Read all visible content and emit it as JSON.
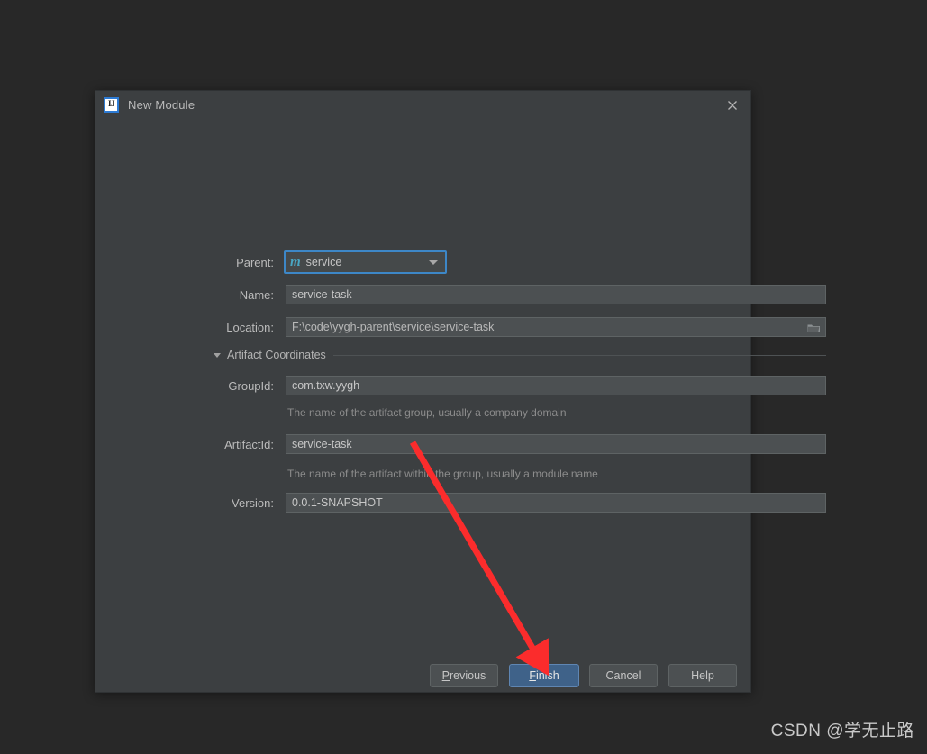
{
  "window": {
    "title": "New Module",
    "app_icon": "intellij-idea-icon",
    "close_icon": "close-icon"
  },
  "form": {
    "parent": {
      "label": "Parent:",
      "value": "service",
      "icon": "maven-module-icon",
      "dropdown_icon": "chevron-down-icon"
    },
    "name": {
      "label": "Name:",
      "value": "service-task"
    },
    "location": {
      "label": "Location:",
      "value": "F:\\code\\yygh-parent\\service\\service-task",
      "browse_icon": "folder-icon"
    },
    "artifact_section": {
      "label": "Artifact Coordinates",
      "expander_icon": "triangle-down-icon",
      "expanded": true
    },
    "group_id": {
      "label": "GroupId:",
      "value": "com.txw.yygh",
      "hint": "The name of the artifact group, usually a company domain"
    },
    "artifact_id": {
      "label": "ArtifactId:",
      "value": "service-task",
      "hint": "The name of the artifact within the group, usually a module name"
    },
    "version": {
      "label": "Version:",
      "value": "0.0.1-SNAPSHOT"
    }
  },
  "buttons": {
    "previous": {
      "label": "Previous",
      "mnemonic": "P"
    },
    "finish": {
      "label": "Finish",
      "mnemonic": "F",
      "primary": true
    },
    "cancel": {
      "label": "Cancel"
    },
    "help": {
      "label": "Help"
    }
  },
  "annotation": {
    "arrow_color": "#fb2c2c",
    "points_to": "finish-button"
  },
  "watermark": {
    "text": "CSDN @学无止路"
  },
  "colors": {
    "page_background": "#282828",
    "dialog_background": "#3c3f41",
    "field_background": "#4c5052",
    "accent_focus": "#3d87c7",
    "primary_button": "#3f6289"
  }
}
